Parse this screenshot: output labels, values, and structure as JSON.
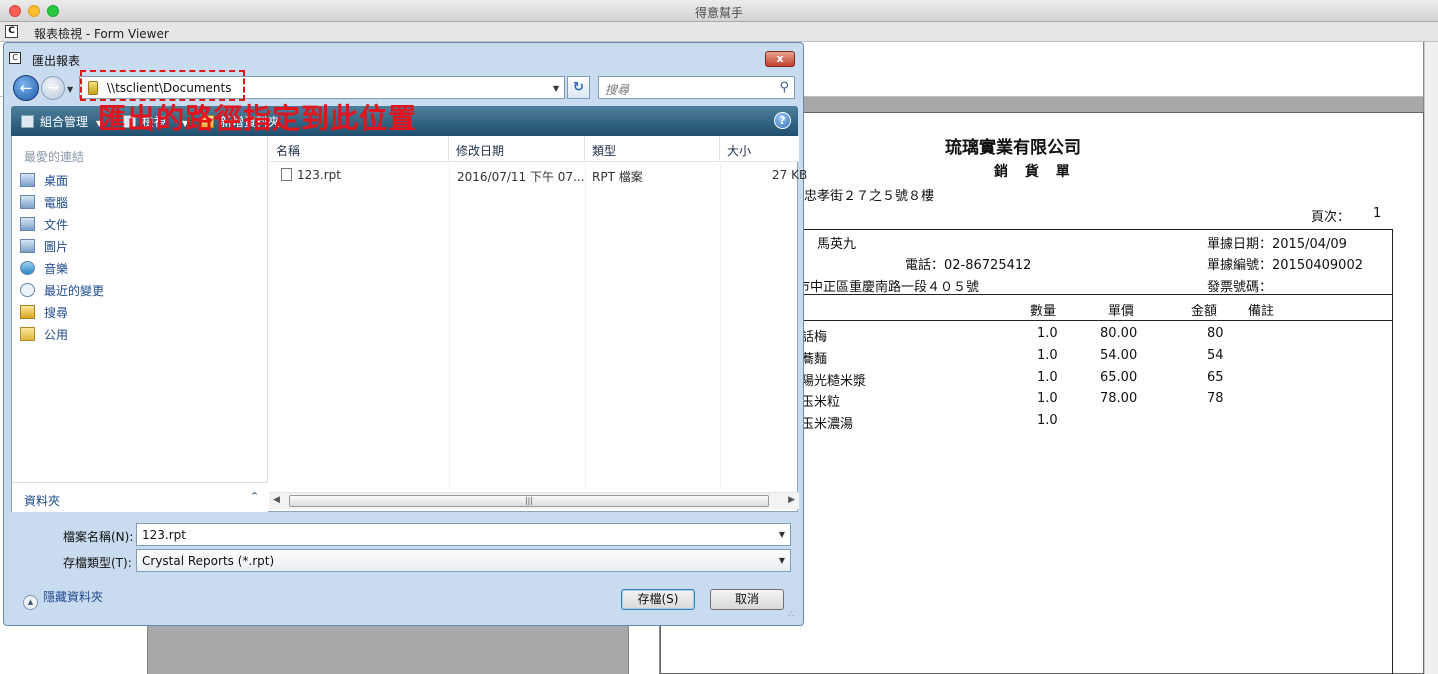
{
  "mac_window": {
    "title": "得意幫手"
  },
  "app": {
    "icon_letter": "C",
    "title": "報表檢視 - Form Viewer"
  },
  "report": {
    "company": "琉璃實業有限公司",
    "document_title": "銷 貨 單",
    "company_address": "區忠孝街２７之５號８樓",
    "page_label": "頁次：",
    "page_number": "1",
    "customer_name": "馬英九",
    "phone": "電話：02-86725412",
    "customer_address": "市中正區重慶南路一段４０５號",
    "doc_date": "單據日期：2015/04/09",
    "doc_number": "單據編號：20150409002",
    "invoice_number": "發票號碼：",
    "columns": {
      "qty": "數量",
      "price": "單價",
      "amount": "金額",
      "note": "備註"
    },
    "items": [
      {
        "name": "話梅",
        "qty": "1.0",
        "price": "80.00",
        "amount": "80"
      },
      {
        "name": "蕎麵",
        "qty": "1.0",
        "price": "54.00",
        "amount": "54"
      },
      {
        "name": "陽光糙米漿",
        "qty": "1.0",
        "price": "65.00",
        "amount": "65"
      },
      {
        "name": "玉米粒",
        "qty": "1.0",
        "price": "78.00",
        "amount": "78"
      },
      {
        "name": "玉米濃湯",
        "qty": "1.0",
        "price": "",
        "amount": ""
      }
    ]
  },
  "dialog": {
    "title": "匯出報表",
    "close_label": "x",
    "address_path": "\\\\tsclient\\Documents",
    "search_placeholder": "搜尋",
    "toolbar": {
      "organize": "組合管理",
      "views": "檢視",
      "new_folder": "新增資料夾",
      "help": "?"
    },
    "favorites_title": "最愛的連結",
    "nav_items": [
      {
        "label": "桌面",
        "icon": "desktop-icon"
      },
      {
        "label": "電腦",
        "icon": "computer-icon"
      },
      {
        "label": "文件",
        "icon": "documents-icon"
      },
      {
        "label": "圖片",
        "icon": "pictures-icon"
      },
      {
        "label": "音樂",
        "icon": "music-icon"
      },
      {
        "label": "最近的變更",
        "icon": "recent-changes-icon"
      },
      {
        "label": "搜尋",
        "icon": "search-folder-icon"
      },
      {
        "label": "公用",
        "icon": "public-folder-icon"
      }
    ],
    "folders_label": "資料夾",
    "columns": {
      "name": "名稱",
      "date": "修改日期",
      "type": "類型",
      "size": "大小"
    },
    "files": [
      {
        "name": "123.rpt",
        "date": "2016/07/11 下午 07...",
        "type": "RPT 檔案",
        "size": "27 KB"
      }
    ],
    "annotation": "匯出的路徑指定到此位置",
    "filename_label": "檔案名稱(N):",
    "filename_value": "123.rpt",
    "filetype_label": "存檔類型(T):",
    "filetype_value": "Crystal Reports (*.rpt)",
    "hide_folders": "隱藏資料夾",
    "save_button": "存檔(S)",
    "cancel_button": "取消"
  }
}
